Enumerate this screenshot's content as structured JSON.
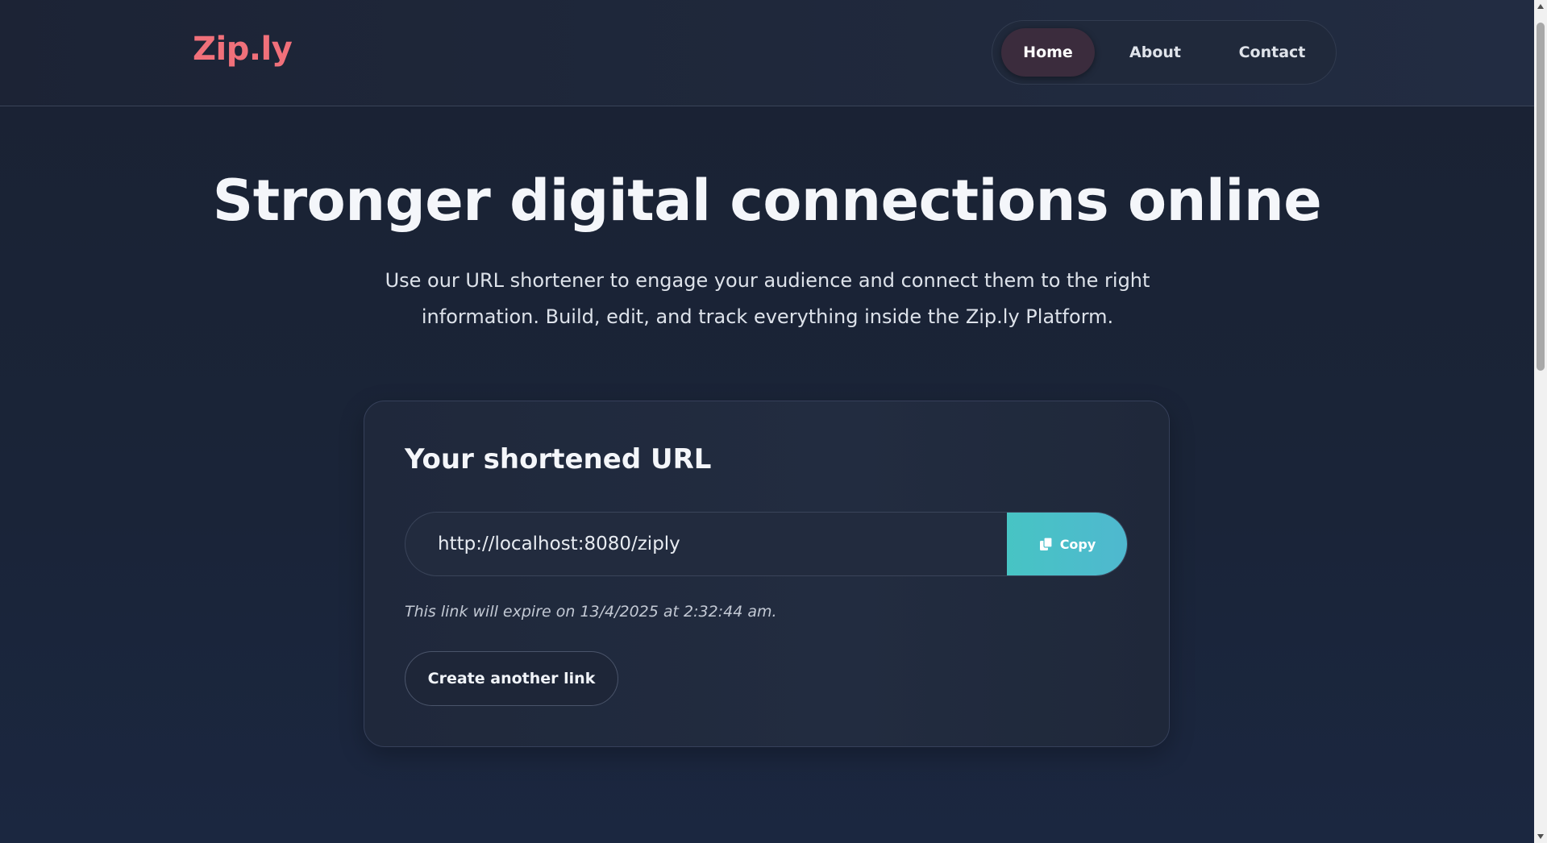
{
  "brand": {
    "logo_text": "Zip.ly",
    "accent_color": "#f0707a"
  },
  "nav": {
    "items": [
      {
        "label": "Home",
        "active": true
      },
      {
        "label": "About",
        "active": false
      },
      {
        "label": "Contact",
        "active": false
      }
    ]
  },
  "hero": {
    "title": "Stronger digital connections online",
    "subtitle": "Use our URL shortener to engage your audience and connect them to the right information. Build, edit, and track everything inside the Zip.ly Platform."
  },
  "result_card": {
    "title": "Your shortened URL",
    "short_url": "http://localhost:8080/ziply",
    "copy_label": "Copy",
    "copy_icon": "copy-icon",
    "copy_color": "#47c4c4",
    "expiry_text": "This link will expire on 13/4/2025 at 2:32:44 am.",
    "create_another_label": "Create another link"
  }
}
